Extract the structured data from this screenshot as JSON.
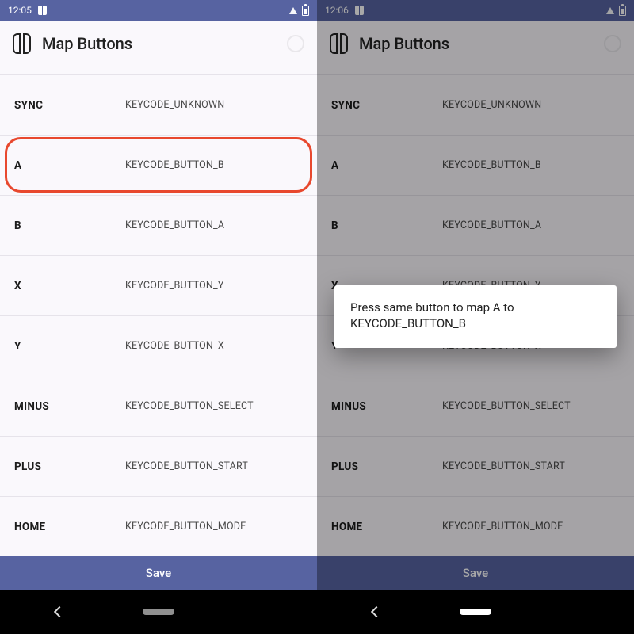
{
  "left": {
    "status": {
      "time": "12:05"
    },
    "title": "Map Buttons",
    "rows": [
      {
        "name": "SYNC",
        "code": "KEYCODE_UNKNOWN"
      },
      {
        "name": "A",
        "code": "KEYCODE_BUTTON_B"
      },
      {
        "name": "B",
        "code": "KEYCODE_BUTTON_A"
      },
      {
        "name": "X",
        "code": "KEYCODE_BUTTON_Y"
      },
      {
        "name": "Y",
        "code": "KEYCODE_BUTTON_X"
      },
      {
        "name": "MINUS",
        "code": "KEYCODE_BUTTON_SELECT"
      },
      {
        "name": "PLUS",
        "code": "KEYCODE_BUTTON_START"
      },
      {
        "name": "HOME",
        "code": "KEYCODE_BUTTON_MODE"
      }
    ],
    "highlight_index": 1,
    "save_label": "Save"
  },
  "right": {
    "status": {
      "time": "12:06"
    },
    "title": "Map Buttons",
    "rows": [
      {
        "name": "SYNC",
        "code": "KEYCODE_UNKNOWN"
      },
      {
        "name": "A",
        "code": "KEYCODE_BUTTON_B"
      },
      {
        "name": "B",
        "code": "KEYCODE_BUTTON_A"
      },
      {
        "name": "X",
        "code": "KEYCODE_BUTTON_Y"
      },
      {
        "name": "Y",
        "code": "KEYCODE_BUTTON_X"
      },
      {
        "name": "MINUS",
        "code": "KEYCODE_BUTTON_SELECT"
      },
      {
        "name": "PLUS",
        "code": "KEYCODE_BUTTON_START"
      },
      {
        "name": "HOME",
        "code": "KEYCODE_BUTTON_MODE"
      }
    ],
    "dialog_text": "Press same button to map A to KEYCODE_BUTTON_B",
    "save_label": "Save"
  },
  "colors": {
    "accent": "#5763a1",
    "highlight": "#e8482e",
    "bg": "#faf8fc"
  }
}
